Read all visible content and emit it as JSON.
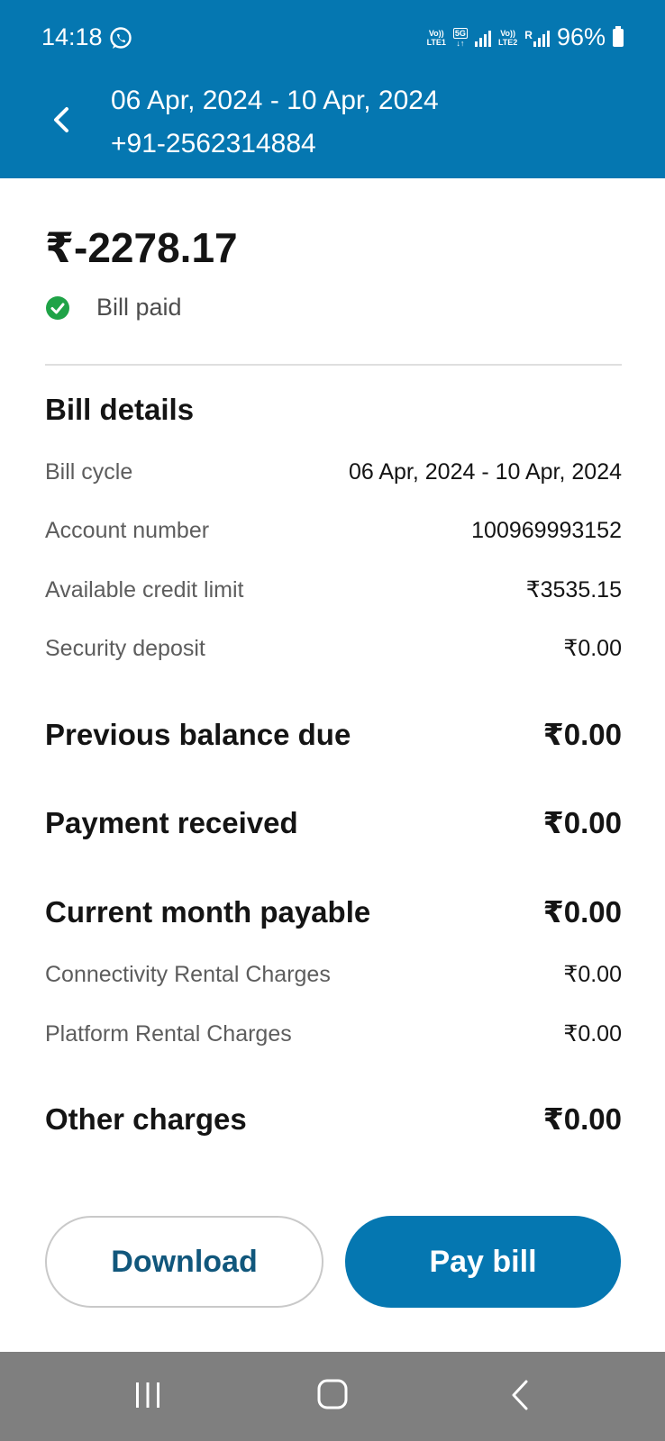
{
  "status_bar": {
    "time": "14:18",
    "sim1_top": "Vo))",
    "sim1_bottom": "LTE1",
    "sim_5g": "5G",
    "sim2_top": "Vo))",
    "sim2_bottom": "LTE2",
    "roaming": "R",
    "battery": "96%"
  },
  "header": {
    "title": "06 Apr, 2024 - 10 Apr, 2024",
    "phone": "+91-2562314884",
    "background": "#0577b1"
  },
  "summary": {
    "amount": "₹-2278.17",
    "status": "Bill paid",
    "status_color": "#1fa347"
  },
  "bill_details": {
    "title": "Bill details",
    "rows": [
      {
        "label": "Bill cycle",
        "value": "06 Apr, 2024 - 10 Apr, 2024"
      },
      {
        "label": "Account number",
        "value": "100969993152"
      },
      {
        "label": "Available credit limit",
        "value": "₹3535.15"
      },
      {
        "label": "Security deposit",
        "value": "₹0.00"
      }
    ]
  },
  "totals": {
    "previous_balance": {
      "label": "Previous balance due",
      "value": "₹0.00"
    },
    "payment_received": {
      "label": "Payment received",
      "value": "₹0.00"
    },
    "current_month": {
      "label": "Current month payable",
      "value": "₹0.00"
    },
    "connectivity": {
      "label": "Connectivity Rental Charges",
      "value": "₹0.00"
    },
    "platform": {
      "label": "Platform Rental Charges",
      "value": "₹0.00"
    },
    "other_charges": {
      "label": "Other charges",
      "value": "₹0.00"
    }
  },
  "actions": {
    "download": "Download",
    "pay_bill": "Pay bill"
  },
  "nav_bar": {
    "icons": [
      "recent-apps-icon",
      "home-icon",
      "back-icon"
    ]
  }
}
